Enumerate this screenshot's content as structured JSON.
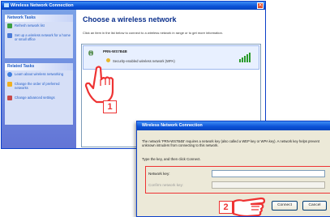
{
  "window": {
    "title": "Wireless Network Connection",
    "close_glyph": "✕"
  },
  "sidebar": {
    "network_tasks_heading": "Network Tasks",
    "network_tasks": [
      {
        "label": "Refresh network list",
        "icon": "refresh-icon"
      },
      {
        "label": "Set up a wireless network for a home or small office",
        "icon": "setup-network-icon"
      }
    ],
    "related_tasks_heading": "Related Tasks",
    "related_tasks": [
      {
        "label": "Learn about wireless networking",
        "icon": "info-icon"
      },
      {
        "label": "Change the order of preferred networks",
        "icon": "star-icon"
      },
      {
        "label": "Change advanced settings",
        "icon": "settings-icon"
      }
    ]
  },
  "main": {
    "title": "Choose a wireless network",
    "description": "Click an item in the list below to connect to a wireless network in range or to get more information.",
    "networks": [
      {
        "name": "PRN-WS7B4B",
        "security": "Security-enabled wireless network (WPA)",
        "signal_bars": 4,
        "icon": "wireless-network-icon"
      }
    ]
  },
  "markers": {
    "step1": "1",
    "step2": "2"
  },
  "dialog": {
    "title": "Wireless Network Connection",
    "text": "The network 'PRN-WS7B4B' requires a network key (also called a WEP key or WPA key). A network key helps prevent unknown intruders from connecting to this network.",
    "prompt": "Type the key, and then click Connect.",
    "network_key_label": "Network key:",
    "network_key_value": "",
    "confirm_key_label": "Confirm network key:",
    "confirm_key_value": "",
    "connect_label": "Connect",
    "cancel_label": "Cancel"
  },
  "colors": {
    "titlebar": "#0a50d6",
    "sidebar": "#6375d6",
    "highlight": "#ee3333"
  }
}
